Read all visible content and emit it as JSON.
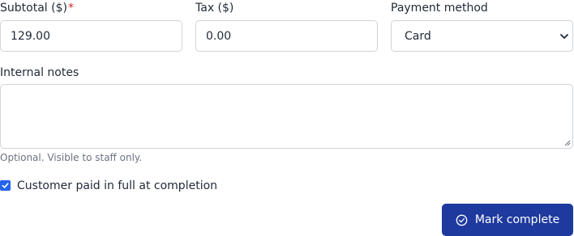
{
  "form": {
    "subtotal": {
      "label": "Subtotal ($)",
      "required_marker": "*",
      "value": "129.00"
    },
    "tax": {
      "label": "Tax ($)",
      "value": "0.00"
    },
    "payment_method": {
      "label": "Payment method",
      "selected": "Card",
      "icon": "chevron-down-icon"
    },
    "internal_notes": {
      "label": "Internal notes",
      "value": "",
      "help": "Optional. Visible to staff only."
    },
    "paid_in_full": {
      "label": "Customer paid in full at completion",
      "checked": true
    },
    "submit": {
      "label": "Mark complete",
      "icon": "check-circle-icon"
    }
  },
  "colors": {
    "primary": "#1e3a9e",
    "checkbox": "#2563eb",
    "required": "#dc2626",
    "help_text": "#6b7280",
    "border": "#cfd4da"
  }
}
